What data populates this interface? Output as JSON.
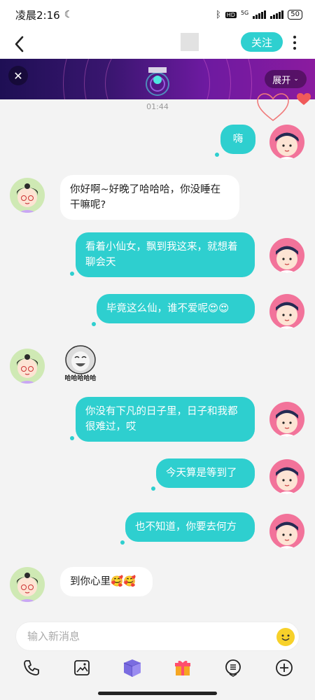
{
  "status_bar": {
    "time": "凌晨2:16",
    "network": "5G",
    "battery": "50"
  },
  "header": {
    "follow_label": "关注"
  },
  "banner": {
    "expand_label": "展开"
  },
  "chat": {
    "timestamp": "01:44",
    "messages": [
      {
        "side": "me",
        "text": "嗨"
      },
      {
        "side": "them",
        "text": "你好啊~好晚了哈哈哈，你没睡在干嘛呢?"
      },
      {
        "side": "me",
        "text": "看着小仙女，飘到我这来，就想着聊会天"
      },
      {
        "side": "me",
        "text": "毕竟这么仙，谁不爱呢😍😍"
      },
      {
        "side": "them",
        "sticker_text": "哈哈哈哈哈"
      },
      {
        "side": "me",
        "text": "你没有下凡的日子里，日子和我都很难过，哎"
      },
      {
        "side": "me",
        "text": "今天算是等到了"
      },
      {
        "side": "me",
        "text": "也不知道，你要去何方"
      },
      {
        "side": "them",
        "text": "到你心里🥰🥰"
      }
    ]
  },
  "input": {
    "placeholder": "输入新消息"
  },
  "toolbar": {
    "items": [
      "phone-icon",
      "image-icon",
      "gift-box-icon",
      "gift-icon",
      "voice-icon",
      "plus-icon"
    ]
  },
  "colors": {
    "accent": "#2ecfcf",
    "banner_start": "#1e0f54",
    "banner_end": "#8b1b9f"
  }
}
